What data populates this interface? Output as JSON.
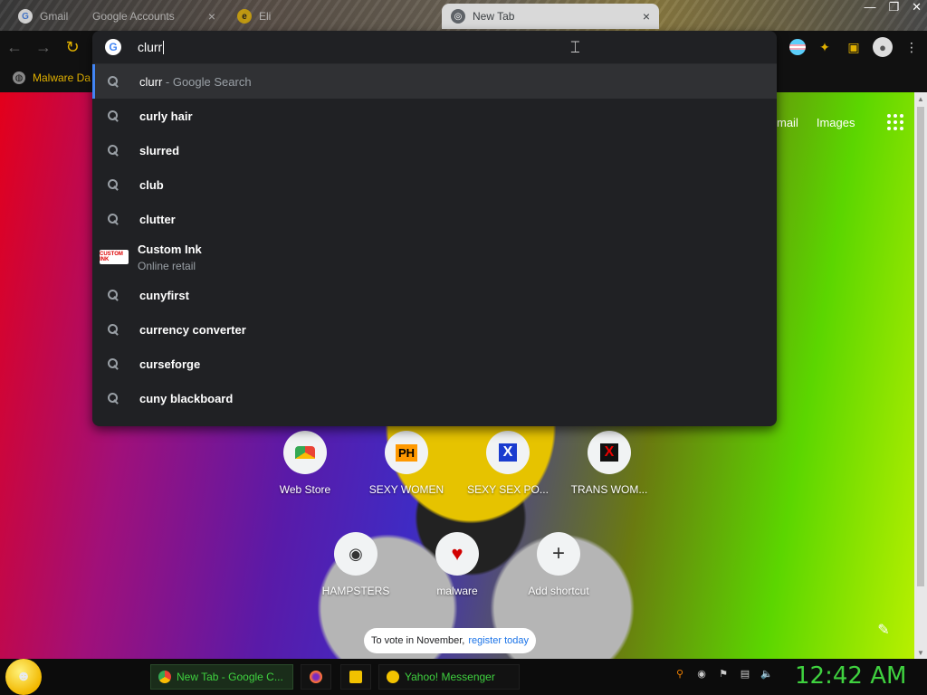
{
  "tabs": [
    {
      "title": "Gmail",
      "state": "inactive",
      "favicon": "google-icon"
    },
    {
      "title": "Google Accounts",
      "state": "inactive",
      "favicon": "google-icon"
    },
    {
      "title": "Eli",
      "state": "inactive",
      "favicon": "generic-icon"
    },
    {
      "title": "New Tab",
      "state": "active",
      "favicon": "chrome-icon"
    }
  ],
  "toolbar": {
    "omnibox_text": "clurr"
  },
  "bookmarks": [
    {
      "label": "Malware Da"
    }
  ],
  "suggestions": [
    {
      "text": "clurr",
      "suffix": " - Google Search",
      "selected": true,
      "type": "search"
    },
    {
      "text": "curly hair",
      "type": "search"
    },
    {
      "text": "slurred",
      "type": "search"
    },
    {
      "text": "club",
      "type": "search"
    },
    {
      "text": "clutter",
      "type": "search"
    },
    {
      "text": "Custom Ink",
      "subtitle": "Online retail",
      "type": "entity",
      "logo_text": "CUSTOM INK"
    },
    {
      "text": "cunyfirst",
      "type": "search"
    },
    {
      "text": "currency converter",
      "type": "search"
    },
    {
      "text": "curseforge",
      "type": "search"
    },
    {
      "text": "cuny blackboard",
      "type": "search"
    }
  ],
  "top_links": {
    "gmail": "mail",
    "images": "Images"
  },
  "shortcuts": [
    {
      "label": "Web Store",
      "icon": "chrome-webstore-icon"
    },
    {
      "label": "SEXY WOMEN",
      "icon": "ph-icon",
      "glyph": "PH"
    },
    {
      "label": "SEXY SEX PO...",
      "icon": "x-blue-icon",
      "glyph": "X"
    },
    {
      "label": "TRANS WOM...",
      "icon": "x-red-icon",
      "glyph": "X"
    },
    {
      "label": "HAMPSTERS",
      "icon": "raccoon-icon",
      "glyph": "◉"
    },
    {
      "label": "malware",
      "icon": "heart-icon",
      "glyph": "♥"
    },
    {
      "label": "Add shortcut",
      "icon": "plus-icon",
      "glyph": "+"
    }
  ],
  "vote_pill": {
    "text": "To vote in November,",
    "link": "register today"
  },
  "taskbar": {
    "items": [
      {
        "label": "New Tab - Google C...",
        "active": true
      },
      {
        "label": "Yahoo! Messenger",
        "active": false
      }
    ],
    "clock": "12:42 AM"
  },
  "colors": {
    "accent": "#e0b000",
    "taskbar_text": "#3fd13f",
    "omnibox_bg": "#202124",
    "selection_bar": "#4285f4"
  }
}
